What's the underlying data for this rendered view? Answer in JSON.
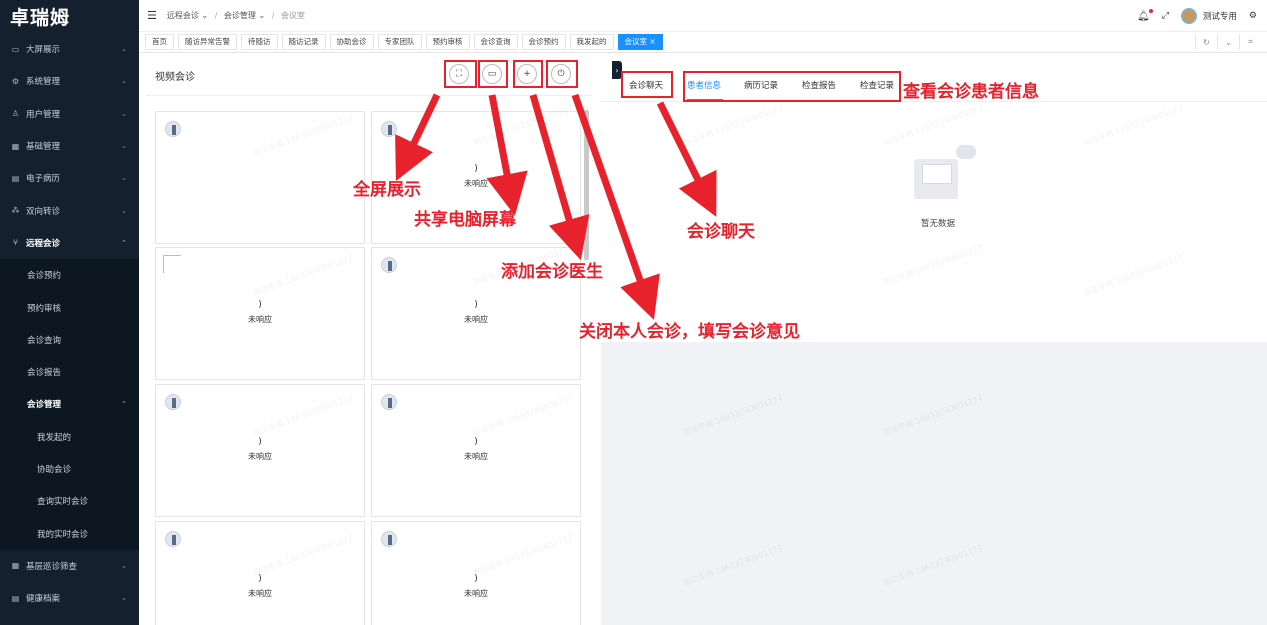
{
  "logo": "卓瑞姆",
  "sidebar": {
    "items": [
      {
        "label": "大屏展示",
        "icon": "monitor-icon"
      },
      {
        "label": "系统管理",
        "icon": "gear-icon"
      },
      {
        "label": "用户管理",
        "icon": "user-icon"
      },
      {
        "label": "基础管理",
        "icon": "grid-icon"
      },
      {
        "label": "电子病历",
        "icon": "record-icon"
      },
      {
        "label": "双向转诊",
        "icon": "share-icon"
      },
      {
        "label": "远程会诊",
        "icon": "branch-icon"
      }
    ],
    "sub_items": [
      "会诊预约",
      "预约审核",
      "会诊查询",
      "会诊报告"
    ],
    "manage_label": "会诊管理",
    "manage_sub": [
      "我发起的",
      "协助会诊",
      "查询实时会诊",
      "我的实时会诊"
    ],
    "bottom_items": [
      {
        "label": "基层巡诊筛查",
        "icon": "grid-icon"
      },
      {
        "label": "健康档案",
        "icon": "record-icon"
      }
    ]
  },
  "header": {
    "breadcrumb": [
      "远程会诊",
      "会诊管理",
      "会议室"
    ],
    "user_name": "测试专用"
  },
  "tabs": [
    "首页",
    "随访异常告警",
    "待随访",
    "随访记录",
    "协助会诊",
    "专家团队",
    "预约审核",
    "会诊查询",
    "会诊预约",
    "我发起的",
    "会议室"
  ],
  "tab_close": "×",
  "video": {
    "title": "视频会诊",
    "cards": [
      {
        "paren": "",
        "status": ""
      },
      {
        "paren": ")",
        "status": "未响应"
      },
      {
        "paren": ")",
        "status": "未响应"
      },
      {
        "paren": ")",
        "status": "未响应"
      },
      {
        "paren": ")",
        "status": "未响应"
      },
      {
        "paren": ")",
        "status": "未响应"
      },
      {
        "paren": ")",
        "status": "未响应"
      },
      {
        "paren": ")",
        "status": "未响应"
      }
    ]
  },
  "right": {
    "tabs": [
      "会诊聊天",
      "患者信息",
      "病历记录",
      "检查报告",
      "检查记录"
    ],
    "empty_text": "暂无数据"
  },
  "annotations": {
    "fullscreen": "全屏展示",
    "share": "共享电脑屏幕",
    "add": "添加会诊医生",
    "close": "关闭本人会诊，填写会诊意见",
    "chat": "会诊聊天",
    "patient": "查看会诊患者信息"
  },
  "watermark": "测试专用 14633240601217",
  "colors": {
    "sidebar_bg": "#14202d",
    "accent": "#1890ff",
    "annotation": "#e8222d"
  }
}
